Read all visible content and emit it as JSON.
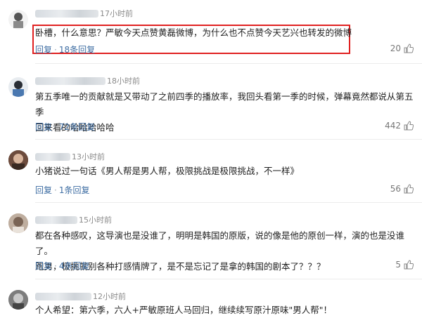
{
  "comments": [
    {
      "time": "17小时前",
      "text": [
        "卧槽，什么意思？严敏今天点赞黄磊微博，为什么也不点赞今天艺兴也转发的微博"
      ],
      "reply": "回复",
      "reply_count": "18条回复",
      "likes": "20",
      "highlighted": true
    },
    {
      "time": "18小时前",
      "text": [
        "第五季唯一的贡献就是又带动了之前四季的播放率，我回头看第一季的时候，弹幕竟然都说从第五季",
        "回来看的哈哈哈哈哈"
      ],
      "reply": "回复",
      "reply_count": "72条回复",
      "likes": "442"
    },
    {
      "time": "13小时前",
      "text": [
        "小猪说过一句话《男人帮是男人帮，极限挑战是极限挑战，不一样》"
      ],
      "reply": "回复",
      "reply_count": "1条回复",
      "likes": "56"
    },
    {
      "time": "15小时前",
      "text": [
        "都在各种感叹，这导演也是没谁了，明明是韩国的原版，说的像是他的原创一样，演的也是没谁了。",
        "跑男，极挑就别各种打感情牌了，是不是忘记了是拿的韩国的剧本了？？？"
      ],
      "reply": "回复",
      "reply_count": "4条回复",
      "likes": "5"
    },
    {
      "time": "12小时前",
      "text": [
        "个人希望：第六季，六人+严敏原班人马回归，继续续写原汁原味\"男人帮\"！"
      ],
      "reply": "",
      "reply_count": "",
      "likes": ""
    }
  ],
  "colors": {
    "link": "#3f6ea3",
    "highlight_border": "#e02020",
    "meta": "#8a8a8a"
  },
  "icons": {
    "like": "thumbs-up-icon"
  }
}
